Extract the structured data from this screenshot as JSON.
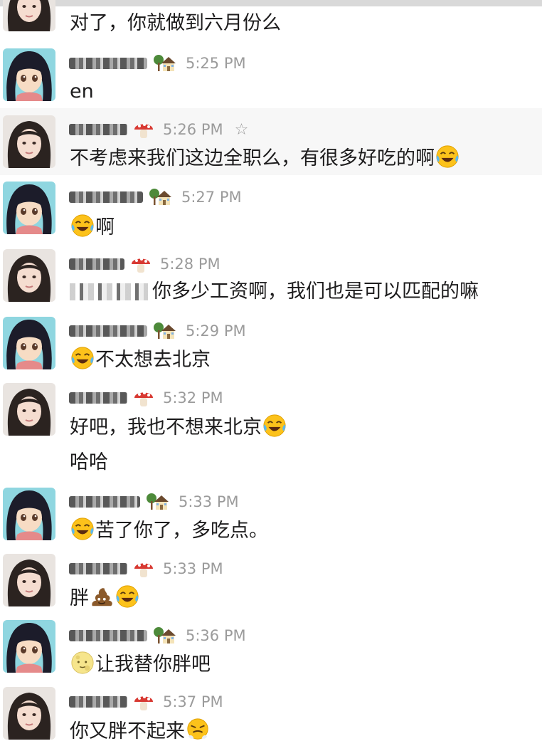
{
  "messages": [
    {
      "text": "对了，你就做到六月份么",
      "avatar": "girl"
    },
    {
      "time": "5:25 PM",
      "status_icon": "house-with-garden",
      "text": "en",
      "avatar": "anime"
    },
    {
      "time": "5:26 PM",
      "status_icon": "mushroom",
      "text": "不考虑来我们这边全职么，有很多好吃的啊",
      "trailing_emoji": "face-with-tears-of-joy",
      "avatar": "girl",
      "highlighted": true
    },
    {
      "time": "5:27 PM",
      "status_icon": "house-with-garden",
      "leading_emoji": "face-with-tears-of-joy",
      "text": "啊",
      "avatar": "anime"
    },
    {
      "time": "5:28 PM",
      "status_icon": "mushroom",
      "text": "你多少工资啊，我们也是可以匹配的嘛",
      "avatar": "girl"
    },
    {
      "time": "5:29 PM",
      "status_icon": "house-with-garden",
      "leading_emoji": "face-with-tears-of-joy",
      "text": "不太想去北京",
      "avatar": "anime"
    },
    {
      "time": "5:32 PM",
      "status_icon": "mushroom",
      "text": "好吧，我也不想来北京",
      "trailing_emoji": "face-with-tears-of-joy",
      "followup": "哈哈",
      "avatar": "girl"
    },
    {
      "time": "5:33 PM",
      "status_icon": "house-with-garden",
      "leading_emoji": "face-with-tears-of-joy",
      "text": "苦了你了，多吃点。",
      "avatar": "anime"
    },
    {
      "time": "5:33 PM",
      "status_icon": "mushroom",
      "text": "胖",
      "trailing_emoji": "pile-of-poo + face-with-tears-of-joy",
      "avatar": "girl"
    },
    {
      "time": "5:36 PM",
      "status_icon": "house-with-garden",
      "leading_emoji": "full-moon-face",
      "text": "让我替你胖吧",
      "avatar": "anime"
    },
    {
      "time": "5:37 PM",
      "status_icon": "mushroom",
      "text": "你又胖不起来",
      "trailing_emoji": "face-with-steam-from-nose",
      "avatar": "girl"
    }
  ]
}
